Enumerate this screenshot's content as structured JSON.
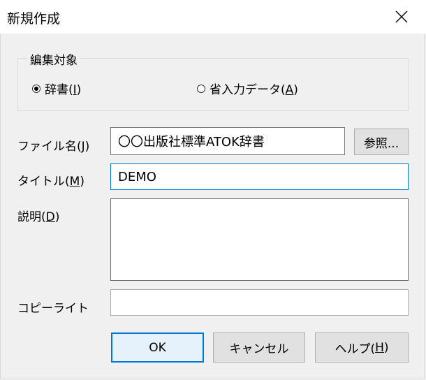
{
  "window": {
    "title": "新規作成",
    "close_icon": "close-icon"
  },
  "edit_target": {
    "legend": "編集対象",
    "options": [
      {
        "label": "辞書(",
        "mnemonic": "I",
        "suffix": ")",
        "selected": true
      },
      {
        "label": "省入力データ(",
        "mnemonic": "A",
        "suffix": ")",
        "selected": false
      }
    ]
  },
  "file": {
    "label": "ファイル名(",
    "mnemonic": "J",
    "suffix": ")",
    "value": "〇〇出版社標準ATOK辞書",
    "browse_label": "参照..."
  },
  "title_field": {
    "label": "タイトル(",
    "mnemonic": "M",
    "suffix": ")",
    "value": "DEMO"
  },
  "description": {
    "label": "説明(",
    "mnemonic": "D",
    "suffix": ")",
    "value": ""
  },
  "copyright": {
    "label": "コピーライト",
    "value": ""
  },
  "buttons": {
    "ok": "OK",
    "cancel": "キャンセル",
    "help_label": "ヘルプ(",
    "help_mnemonic": "H",
    "help_suffix": ")"
  },
  "colors": {
    "focus_border": "#0078d7",
    "dialog_bg": "#f0f0f0"
  }
}
